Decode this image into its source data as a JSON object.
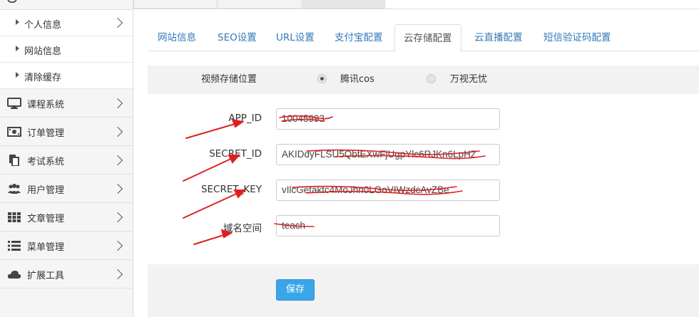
{
  "sidebar": {
    "sub_items": [
      {
        "label": "个人信息"
      },
      {
        "label": "网站信息"
      },
      {
        "label": "清除缓存"
      }
    ],
    "main_items": [
      {
        "label": "课程系统",
        "icon": "monitor-icon"
      },
      {
        "label": "订单管理",
        "icon": "money-icon"
      },
      {
        "label": "考试系统",
        "icon": "copy-icon"
      },
      {
        "label": "用户管理",
        "icon": "users-icon"
      },
      {
        "label": "文章管理",
        "icon": "grid-icon"
      },
      {
        "label": "菜单管理",
        "icon": "list-icon"
      },
      {
        "label": "扩展工具",
        "icon": "cloud-icon"
      }
    ]
  },
  "tabs": [
    {
      "label": "网站信息"
    },
    {
      "label": "SEO设置"
    },
    {
      "label": "URL设置"
    },
    {
      "label": "支付宝配置"
    },
    {
      "label": "云存储配置",
      "active": true
    },
    {
      "label": "云直播配置"
    },
    {
      "label": "短信验证码配置"
    }
  ],
  "form": {
    "storage_label": "视频存储位置",
    "storage_options": [
      {
        "label": "腾讯cos",
        "selected": true
      },
      {
        "label": "万视无忧",
        "selected": false
      }
    ],
    "fields": [
      {
        "label": "APP_ID",
        "value": "10045993"
      },
      {
        "label": "SECRET_ID",
        "value": "AKIDdyFLSU5QbtEXwFjUgpYlc6RJKn6LpHZ"
      },
      {
        "label": "SECRET_KEY",
        "value": "vIlcGetaktc4MoJhn0LGoVIWzdcAvZBe"
      },
      {
        "label": "域名空间",
        "value": "teach"
      }
    ],
    "save_label": "保存"
  },
  "colors": {
    "link": "#337ab7",
    "save_button": "#3aa6e8",
    "annotation_red": "#e02020"
  }
}
